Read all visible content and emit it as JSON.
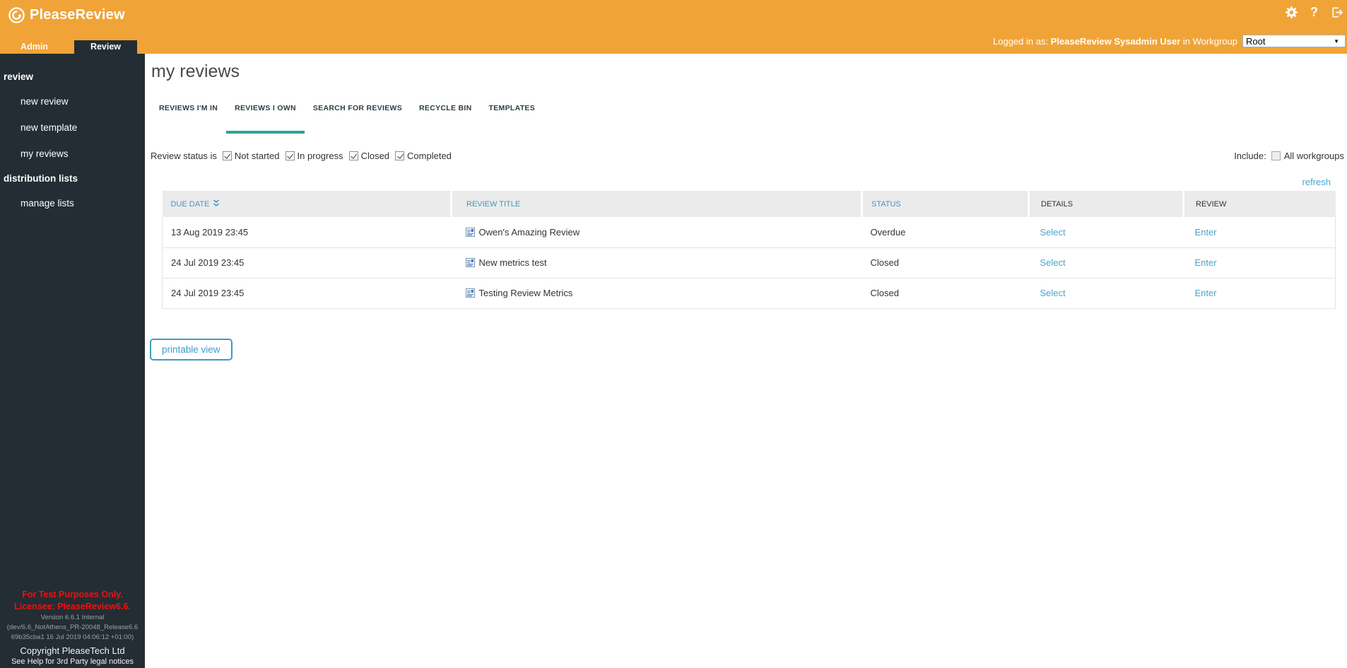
{
  "colors": {
    "header_orange": "#F0A437",
    "sidebar_dark": "#232D33",
    "active_tab_teal": "#2BA392",
    "link_blue": "#4BA4CA",
    "sort_header_blue": "#4597BE",
    "license_red": "#EE1111"
  },
  "header": {
    "brand": "PleaseReview",
    "icons": [
      "gear-icon",
      "help-icon",
      "logout-icon"
    ],
    "logged_in_prefix": "Logged in as:",
    "user_name": "PleaseReview Sysadmin User",
    "logged_in_suffix": "in Workgroup",
    "workgroup_value": "Root",
    "tabs": [
      {
        "label": "Admin",
        "active": false
      },
      {
        "label": "Review",
        "active": true
      }
    ]
  },
  "sidebar": {
    "sections": [
      {
        "label": "review",
        "items": [
          "new review",
          "new template",
          "my reviews"
        ]
      },
      {
        "label": "distribution lists",
        "items": [
          "manage lists"
        ]
      }
    ],
    "license": {
      "red_lines": [
        "For Test Purposes Only.",
        "Licensee: PleaseReview6.6."
      ],
      "gray_lines": [
        "Version 6.6.1 Internal",
        "(dev/6.6_NotAthens_PR-20048_Release6.6",
        "69b35cba1 16 Jul 2019 04:06:12 +01:00)"
      ],
      "copyright": "Copyright PleaseTech Ltd",
      "help": "See Help for 3rd Party legal notices"
    }
  },
  "main": {
    "title": "my reviews",
    "tabs": [
      {
        "label": "REVIEWS I'M IN",
        "active": false
      },
      {
        "label": "REVIEWS I OWN",
        "active": true
      },
      {
        "label": "SEARCH FOR REVIEWS",
        "active": false
      },
      {
        "label": "RECYCLE BIN",
        "active": false
      },
      {
        "label": "TEMPLATES",
        "active": false
      }
    ],
    "filter": {
      "label": "Review status is",
      "options": [
        {
          "label": "Not started",
          "checked": true
        },
        {
          "label": "In progress",
          "checked": true
        },
        {
          "label": "Closed",
          "checked": true
        },
        {
          "label": "Completed",
          "checked": true
        }
      ]
    },
    "include": {
      "label": "Include:",
      "option": {
        "label": "All workgroups",
        "checked": false
      }
    },
    "refresh_label": "refresh",
    "table": {
      "columns": [
        {
          "label": "DUE DATE",
          "sortable": true,
          "sorted": true
        },
        {
          "label": "REVIEW TITLE",
          "sortable": true,
          "sorted": false
        },
        {
          "label": "STATUS",
          "sortable": true,
          "sorted": false
        },
        {
          "label": "DETAILS",
          "sortable": false,
          "sorted": false
        },
        {
          "label": "REVIEW",
          "sortable": false,
          "sorted": false
        }
      ],
      "rows": [
        {
          "due_date": "13 Aug 2019 23:45",
          "title": "Owen's Amazing Review",
          "status": "Overdue",
          "details": "Select",
          "review": "Enter"
        },
        {
          "due_date": "24 Jul 2019 23:45",
          "title": "New metrics test",
          "status": "Closed",
          "details": "Select",
          "review": "Enter"
        },
        {
          "due_date": "24 Jul 2019 23:45",
          "title": "Testing Review Metrics",
          "status": "Closed",
          "details": "Select",
          "review": "Enter"
        }
      ]
    },
    "printable_label": "printable view"
  }
}
